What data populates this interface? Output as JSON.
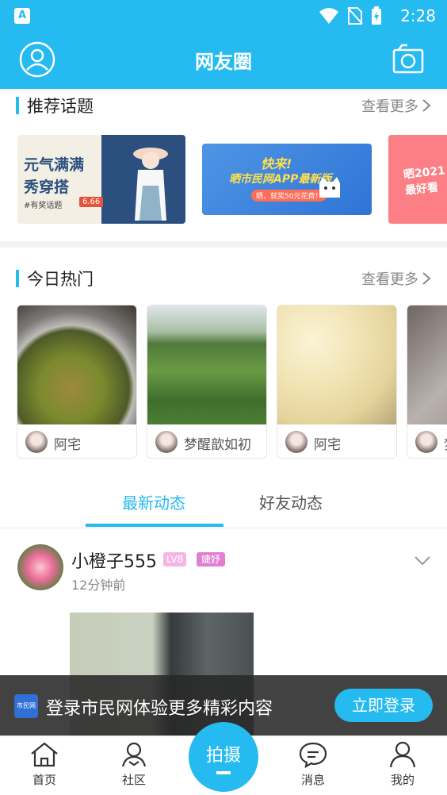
{
  "status_bar": {
    "time": "2:28",
    "app_indicator": "A"
  },
  "header": {
    "title": "网友圈",
    "left_icon": "user-icon",
    "right_icon": "camera-icon"
  },
  "recommended": {
    "title": "推荐话题",
    "more": "查看更多",
    "banners": [
      {
        "headline": "元气满满\n秀穿搭",
        "sub": "#有奖话题",
        "tag": "6.66"
      },
      {
        "headline": "快来!",
        "sub": "晒市民网APP最新版",
        "small": "晒，就奖50元花费！"
      },
      {
        "headline": "晒2021\n最好看"
      }
    ]
  },
  "hot_today": {
    "title": "今日热门",
    "more": "查看更多",
    "cards": [
      {
        "author": "阿宅"
      },
      {
        "author": "梦醒歆如初"
      },
      {
        "author": "阿宅"
      },
      {
        "author": "梦"
      }
    ]
  },
  "feed_tabs": [
    {
      "label": "最新动态",
      "active": true
    },
    {
      "label": "好友动态",
      "active": false
    }
  ],
  "post": {
    "username": "小橙子555",
    "level": "LV8",
    "badge": "婕妤",
    "time": "12分钟前"
  },
  "login_prompt": {
    "logo_text": "市民网",
    "message": "登录市民网体验更多精彩内容",
    "button": "立即登录"
  },
  "bottom_nav": {
    "items": [
      {
        "label": "首页",
        "icon": "home-icon"
      },
      {
        "label": "社区",
        "icon": "community-icon"
      },
      {
        "label": "消息",
        "icon": "message-icon"
      },
      {
        "label": "我的",
        "icon": "profile-icon"
      }
    ],
    "center": {
      "label": "拍摄"
    }
  },
  "colors": {
    "accent": "#25baf0",
    "divider": "#f2f2f2"
  }
}
